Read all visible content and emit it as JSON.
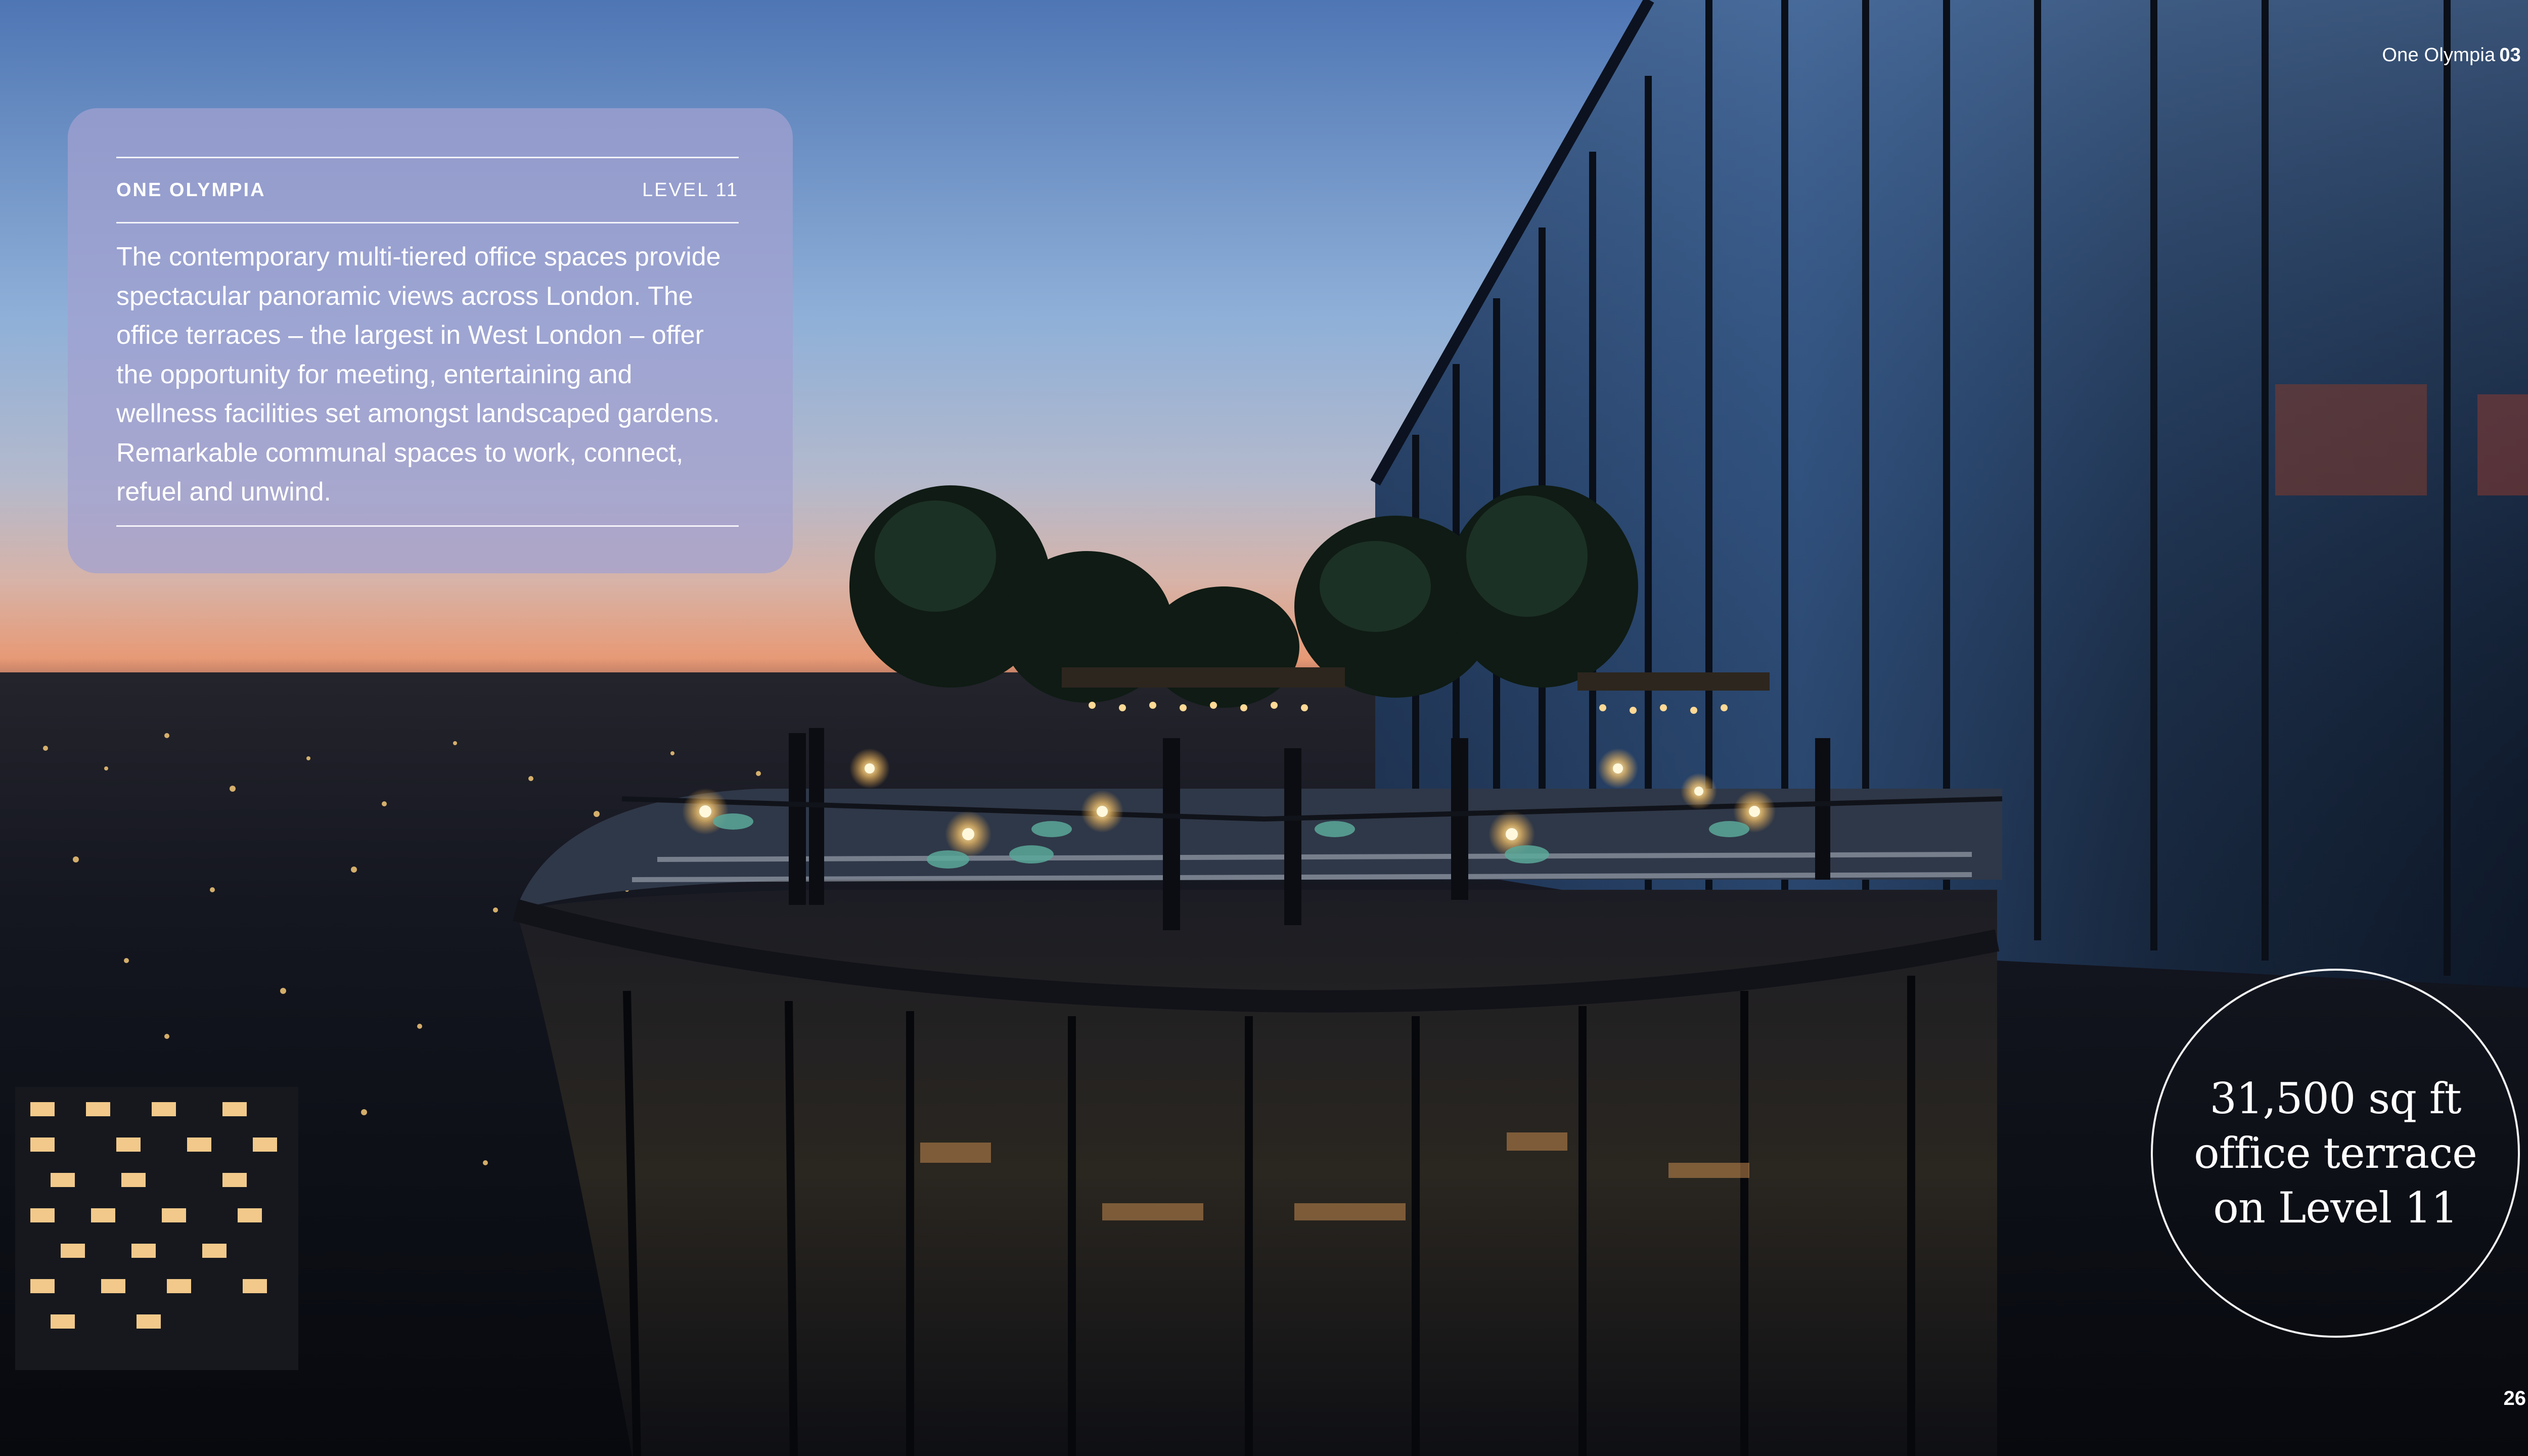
{
  "header": {
    "document_title": "One Olympia",
    "section_number": "03"
  },
  "info_card": {
    "brand": "ONE OLYMPIA",
    "level": "LEVEL 11",
    "body": "The contemporary multi-tiered office spaces provide spectacular panoramic views across London. The office terraces – the largest in West London – offer the opportunity for meeting, entertaining and wellness facilities set amongst landscaped gardens. Remarkable communal spaces to work, connect, refuel and unwind."
  },
  "highlight": {
    "line1": "31,500 sq ft",
    "line2": "office terrace",
    "line3": "on Level 11"
  },
  "footer": {
    "page_number": "26"
  },
  "colors": {
    "card_background": "#a2a0d0",
    "text": "#ffffff",
    "sky_top": "#4f76b4",
    "horizon_glow": "#e79a76",
    "night_city": "#0c0f16"
  }
}
